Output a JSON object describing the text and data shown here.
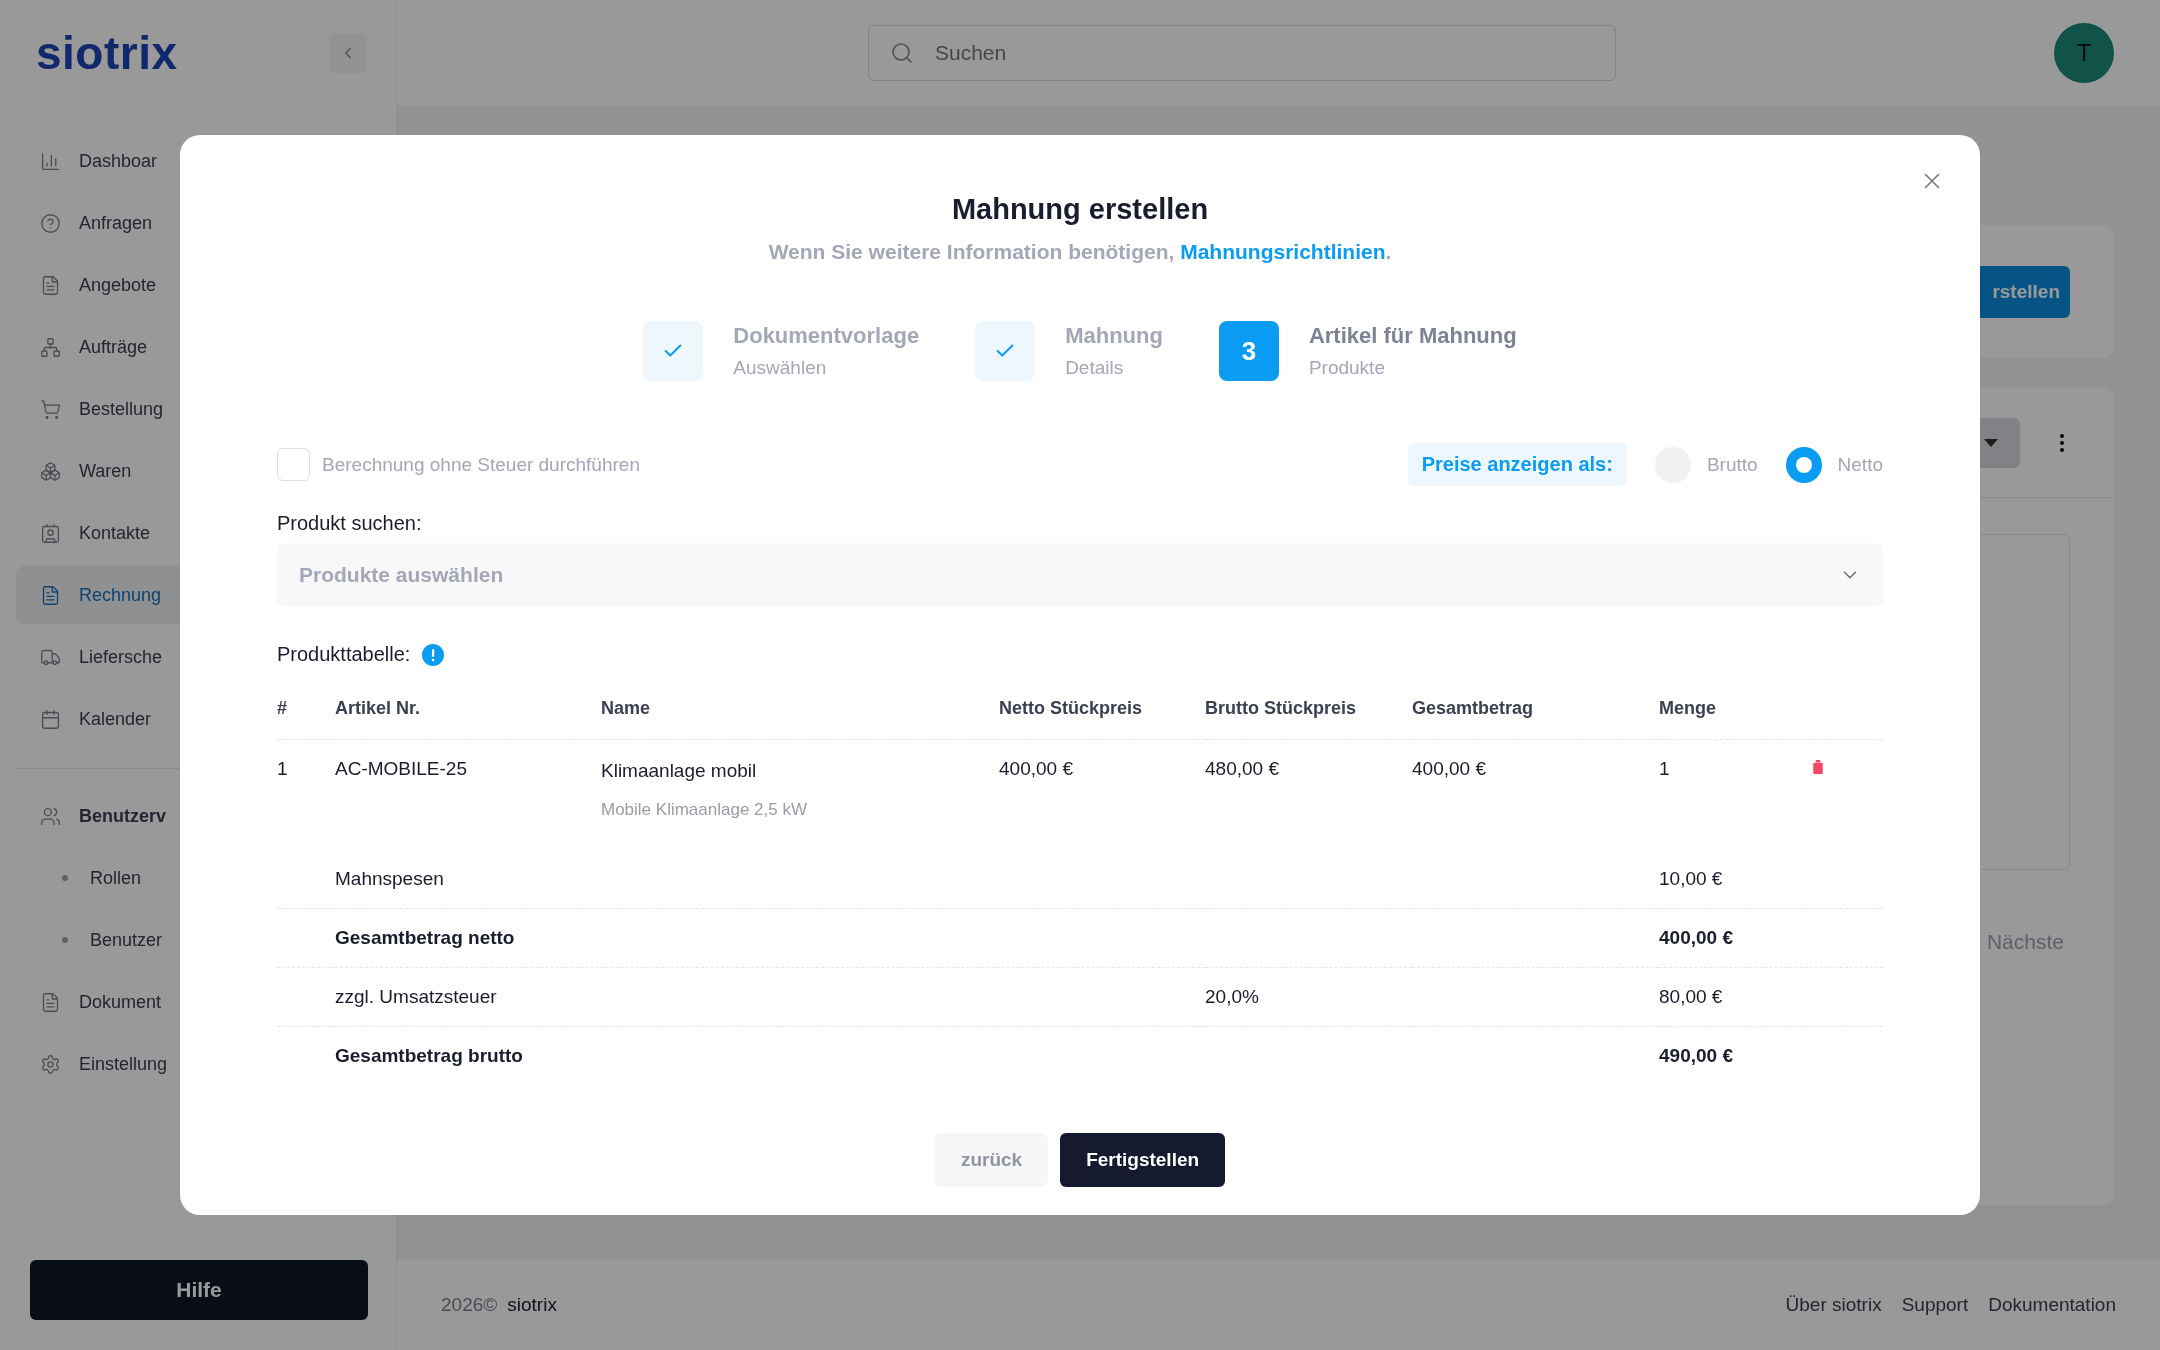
{
  "app": {
    "logo": "siotrix"
  },
  "sidebar": {
    "sections": [
      {
        "items": [
          {
            "label": "Dashboar",
            "selected": false
          },
          {
            "label": "Anfragen",
            "selected": false
          },
          {
            "label": "Angebote",
            "selected": false
          },
          {
            "label": "Aufträge",
            "selected": false
          },
          {
            "label": "Bestellung",
            "selected": false
          },
          {
            "label": "Waren",
            "selected": false
          },
          {
            "label": "Kontakte",
            "selected": false
          },
          {
            "label": "Rechnung",
            "selected": true
          },
          {
            "label": "Liefersche",
            "selected": false
          },
          {
            "label": "Kalender",
            "selected": false
          }
        ]
      },
      {
        "items": [
          {
            "label": "Benutzerv",
            "selected": false,
            "expanded": true,
            "children": [
              {
                "label": "Rollen",
                "selected": false
              },
              {
                "label": "Benutzer",
                "selected": false
              }
            ]
          },
          {
            "label": "Dokument",
            "selected": false
          },
          {
            "label": "Einstellung",
            "selected": false
          }
        ]
      }
    ],
    "help_button": "Hilfe"
  },
  "topbar": {
    "search": {
      "placeholder": "Suchen"
    },
    "avatar": "T"
  },
  "background": {
    "create_button": "rstellen",
    "pagination_next": "Nächste"
  },
  "footer": {
    "copyright": "2026©",
    "brand": "siotrix",
    "links": [
      "Über siotrix",
      "Support",
      "Dokumentation"
    ]
  },
  "dialog": {
    "title": "Mahnung erstellen",
    "subtitle": {
      "text": "Wenn Sie weitere Information benötigen,",
      "link": "Mahnungsrichtlinien",
      "end": "."
    },
    "steps": [
      {
        "title": "Dokumentvorlage",
        "subtitle": "Auswählen",
        "completed": true
      },
      {
        "title": "Mahnung",
        "subtitle": "Details",
        "completed": true
      },
      {
        "title": "Artikel für Mahnung",
        "subtitle": "Produkte",
        "completed": false,
        "number": "3"
      }
    ],
    "tax_free": {
      "label": "Berechnung ohne Steuer durchführen",
      "checked": false
    },
    "price_display": {
      "label": "Preise anzeigen als:",
      "options": [
        {
          "label": "Brutto",
          "selected": false
        },
        {
          "label": "Netto",
          "selected": true
        }
      ]
    },
    "product_search": {
      "label": "Produkt suchen:",
      "placeholder": "Produkte auswählen"
    },
    "product_table": {
      "title": "Produkttabelle:",
      "columns": [
        "#",
        "Artikel Nr.",
        "Name",
        "Netto Stückpreis",
        "Brutto Stückpreis",
        "Gesamtbetrag",
        "Menge"
      ],
      "rows": [
        {
          "index": "1",
          "article_no": "AC-MOBILE-25",
          "name": "Klimaanlage mobil",
          "description": "Mobile Klimaanlage 2,5 kW",
          "net_unit_price": "400,00 €",
          "gross_unit_price": "480,00 €",
          "total": "400,00 €",
          "quantity": "1"
        }
      ],
      "summary": [
        {
          "label": "Mahnspesen",
          "value": "10,00 €",
          "bold": false
        },
        {
          "label": "Gesamtbetrag netto",
          "value": "400,00 €",
          "bold": true
        },
        {
          "label": "zzgl. Umsatzsteuer",
          "rate": "20,0%",
          "value": "80,00 €",
          "bold": false
        },
        {
          "label": "Gesamtbetrag brutto",
          "value": "490,00 €",
          "bold": true
        }
      ]
    },
    "buttons": {
      "back": "zurück",
      "finish": "Fertigstellen"
    }
  }
}
